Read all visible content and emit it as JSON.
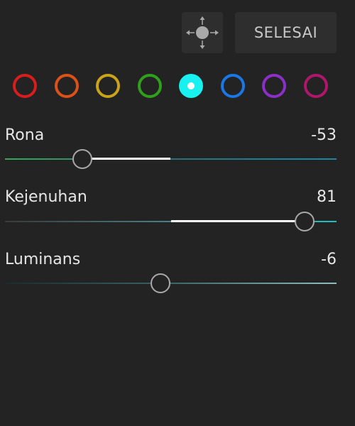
{
  "header": {
    "done_label": "SELESAI"
  },
  "icons": {
    "target_adjust": "target-adjust-icon"
  },
  "color_swatches": [
    {
      "name": "red",
      "color": "#d81d1d",
      "selected": false
    },
    {
      "name": "orange",
      "color": "#dd5118",
      "selected": false
    },
    {
      "name": "yellow",
      "color": "#c9a41a",
      "selected": false
    },
    {
      "name": "green",
      "color": "#2f9f1c",
      "selected": false
    },
    {
      "name": "aqua",
      "color": "#19f1f1",
      "selected": true
    },
    {
      "name": "blue",
      "color": "#1a78e6",
      "selected": false
    },
    {
      "name": "purple",
      "color": "#8a2fc7",
      "selected": false
    },
    {
      "name": "magenta",
      "color": "#b0176a",
      "selected": false
    }
  ],
  "sliders": {
    "hue": {
      "label": "Rona",
      "value": "-53",
      "numeric_value": -53,
      "min": -100,
      "max": 100,
      "gradient": [
        "#3aa65a",
        "#2a6f78",
        "#1c86a6"
      ]
    },
    "saturation": {
      "label": "Kejenuhan",
      "value": "81",
      "numeric_value": 81,
      "min": -100,
      "max": 100,
      "gradient": [
        "#3a3a3a",
        "#4a7f84",
        "#1fc0c0"
      ]
    },
    "luminance": {
      "label": "Luminans",
      "value": "-6",
      "numeric_value": -6,
      "min": -100,
      "max": 100,
      "gradient": [
        "#1a2b2b",
        "#3a6666",
        "#8fbcbc"
      ]
    }
  },
  "colors": {
    "background": "#232323",
    "button_background": "#2e2e2e",
    "fill": "#ffffff",
    "knob_border": "#a8a8a8"
  }
}
